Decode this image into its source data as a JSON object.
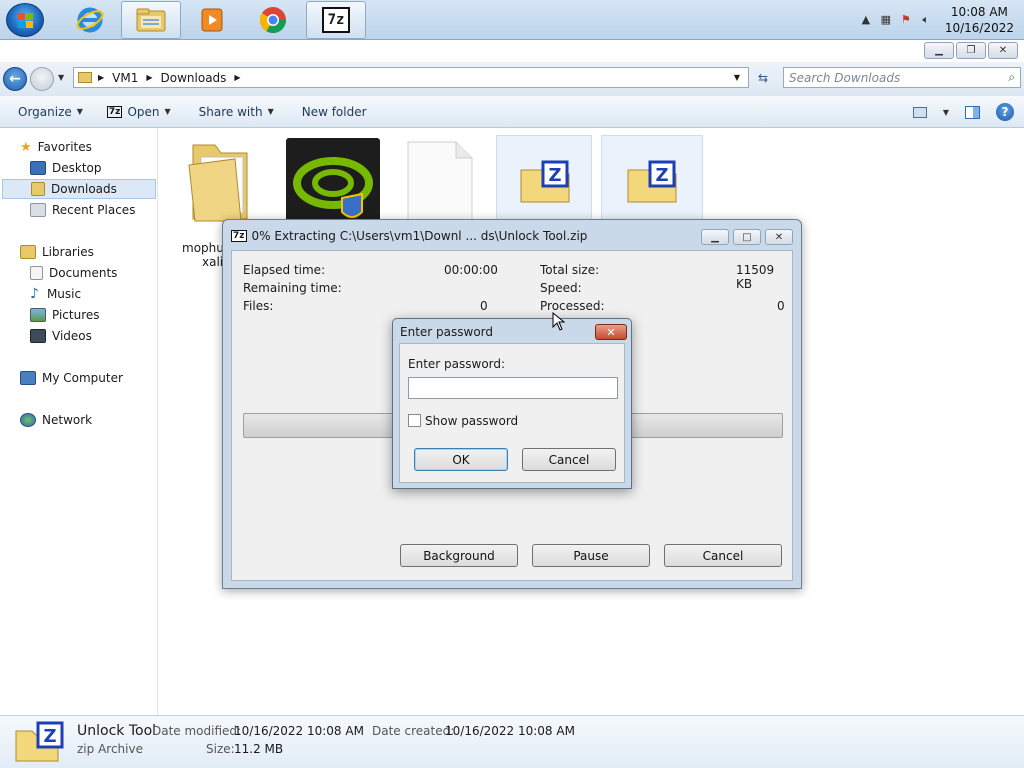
{
  "taskbar": {
    "clock_time": "10:08 AM",
    "clock_date": "10/16/2022",
    "icons": [
      "start-orb",
      "ie-icon",
      "explorer-icon",
      "media-player-icon",
      "chrome-icon",
      "7zip-icon"
    ]
  },
  "explorer": {
    "breadcrumb": [
      "VM1",
      "Downloads"
    ],
    "search_placeholder": "Search Downloads",
    "commands": {
      "organize": "Organize",
      "open": "Open",
      "share_with": "Share with",
      "new_folder": "New folder"
    },
    "sidebar": {
      "favorites": "Favorites",
      "desktop": "Desktop",
      "downloads": "Downloads",
      "recent_places": "Recent Places",
      "libraries": "Libraries",
      "documents": "Documents",
      "music": "Music",
      "pictures": "Pictures",
      "videos": "Videos",
      "my_computer": "My Computer",
      "network": "Network"
    },
    "file_partial_1": "mophu",
    "file_partial_2": "xali"
  },
  "status": {
    "name": "Unlock Tool",
    "type": "zip Archive",
    "date_modified_label": "Date modified:",
    "date_modified": "10/16/2022 10:08 AM",
    "date_created_label": "Date created:",
    "date_created": "10/16/2022 10:08 AM",
    "size_label": "Size:",
    "size": "11.2 MB"
  },
  "extract_dialog": {
    "title": "0% Extracting C:\\Users\\vm1\\Downl ... ds\\Unlock Tool.zip",
    "elapsed_label": "Elapsed time:",
    "elapsed_value": "00:00:00",
    "remaining_label": "Remaining time:",
    "files_label": "Files:",
    "files_value": "0",
    "total_size_label": "Total size:",
    "total_size_value": "11509 KB",
    "speed_label": "Speed:",
    "processed_label": "Processed:",
    "processed_value": "0",
    "progress": 0,
    "background_btn": "Background",
    "pause_btn": "Pause",
    "cancel_btn": "Cancel"
  },
  "password_dialog": {
    "title": "Enter password",
    "label": "Enter password:",
    "value": "",
    "show_password_label": "Show password",
    "show_password_checked": false,
    "ok_btn": "OK",
    "cancel_btn": "Cancel"
  }
}
